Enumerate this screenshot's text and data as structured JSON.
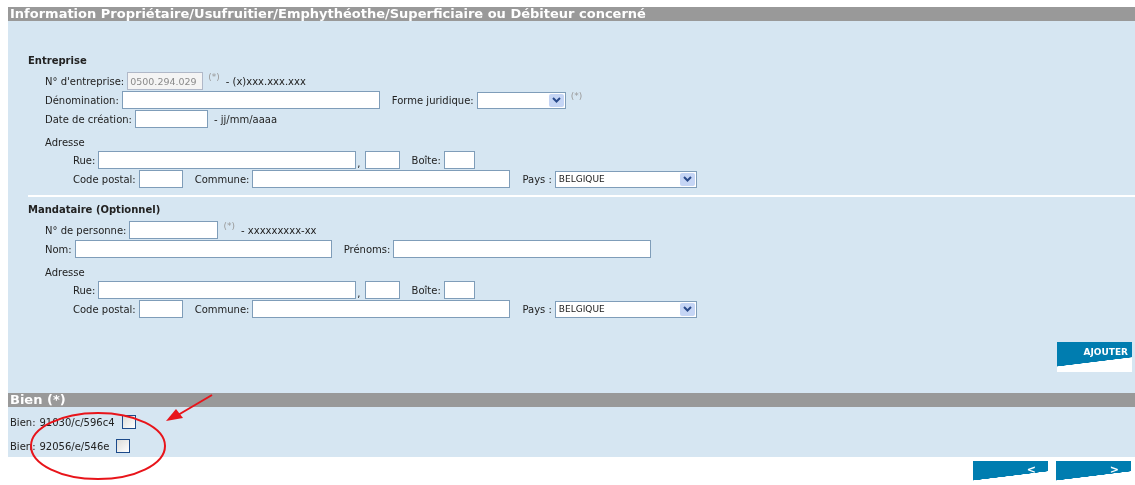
{
  "header": {
    "title": "Information Propriétaire/Usufruitier/Emphythéothe/Superficiaire ou Débiteur concerné"
  },
  "sections": [
    {
      "title": "Entreprise",
      "rows": [
        [
          {
            "kind": "label",
            "text": "N° d'entreprise:"
          },
          {
            "kind": "input",
            "value": "0500.294.029",
            "disabled": true
          },
          {
            "kind": "required",
            "text": "(*)"
          },
          {
            "kind": "note",
            "text": "- (x)xxx.xxx.xxx"
          }
        ],
        [
          {
            "kind": "label",
            "text": "Dénomination:"
          },
          {
            "kind": "input"
          },
          {
            "kind": "label",
            "text": "Forme juridique:"
          },
          {
            "kind": "select"
          },
          {
            "kind": "required",
            "text": "(*)"
          }
        ],
        [
          {
            "kind": "label",
            "text": "Date de création:"
          },
          {
            "kind": "input"
          },
          {
            "kind": "note",
            "text": "- jj/mm/aaaa"
          }
        ]
      ],
      "address": {
        "title": "Adresse",
        "rows": [
          [
            {
              "kind": "label",
              "text": "Rue:"
            },
            {
              "kind": "input"
            },
            {
              "kind": "sep",
              "text": ","
            },
            {
              "kind": "input"
            },
            {
              "kind": "label",
              "text": "Boîte:"
            },
            {
              "kind": "input"
            }
          ],
          [
            {
              "kind": "label",
              "text": "Code postal:"
            },
            {
              "kind": "input"
            },
            {
              "kind": "label",
              "text": "Commune:"
            },
            {
              "kind": "input"
            },
            {
              "kind": "label",
              "text": "Pays :"
            },
            {
              "kind": "select",
              "value": "BELGIQUE"
            }
          ]
        ]
      }
    },
    {
      "title": "Mandataire (Optionnel)",
      "rows": [
        [
          {
            "kind": "label",
            "text": "N° de personne:"
          },
          {
            "kind": "input"
          },
          {
            "kind": "required",
            "text": "(*)"
          },
          {
            "kind": "note",
            "text": "- xxxxxxxxx-xx"
          }
        ],
        [
          {
            "kind": "label",
            "text": "Nom:"
          },
          {
            "kind": "input"
          },
          {
            "kind": "label",
            "text": "Prénoms:"
          },
          {
            "kind": "input"
          }
        ]
      ],
      "address": {
        "title": "Adresse",
        "rows": [
          [
            {
              "kind": "label",
              "text": "Rue:"
            },
            {
              "kind": "input"
            },
            {
              "kind": "sep",
              "text": ","
            },
            {
              "kind": "input"
            },
            {
              "kind": "label",
              "text": "Boîte:"
            },
            {
              "kind": "input"
            }
          ],
          [
            {
              "kind": "label",
              "text": "Code postal:"
            },
            {
              "kind": "input"
            },
            {
              "kind": "label",
              "text": "Commune:"
            },
            {
              "kind": "input"
            },
            {
              "kind": "label",
              "text": "Pays :"
            },
            {
              "kind": "select",
              "value": "BELGIQUE"
            }
          ]
        ]
      }
    }
  ],
  "add_button": "AJOUTER",
  "bien": {
    "title": "Bien (*)",
    "items": [
      {
        "label": "Bien:",
        "value": "91030/c/596c4",
        "checked": false
      },
      {
        "label": "Bien:",
        "value": "92056/e/546e",
        "checked": false
      }
    ]
  },
  "nav": [
    "<",
    ">"
  ]
}
